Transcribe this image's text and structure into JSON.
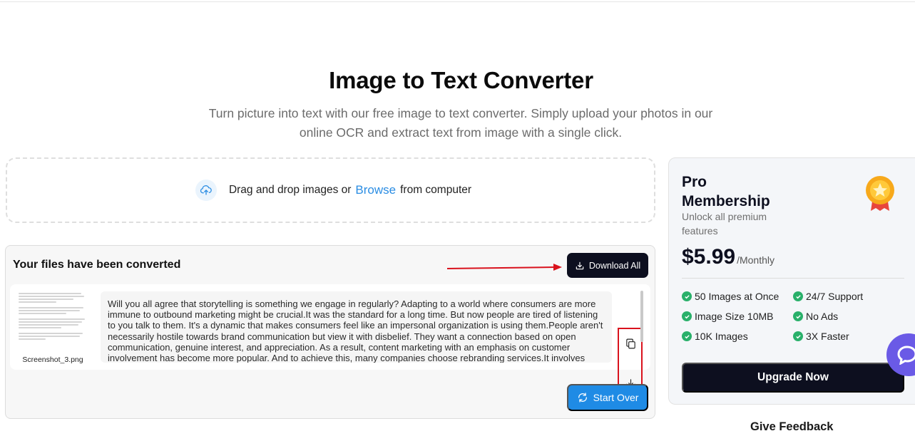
{
  "hero": {
    "title": "Image to Text Converter",
    "subtitle_line1": "Turn picture into text with our free image to text converter. Simply upload your photos in our",
    "subtitle_line2": "online OCR and extract text from image with a single click."
  },
  "upload": {
    "text_before": "Drag and drop images or",
    "browse_link": "Browse",
    "text_after": "from computer",
    "icon": "cloud-upload-icon"
  },
  "results": {
    "title": "Your files have been converted",
    "download_all_label": "Download All",
    "start_over_label": "Start Over",
    "files": [
      {
        "file_name": "Screenshot_3.png",
        "ocr_text": "Will you all agree that storytelling is something we engage in regularly? Adapting to a world where consumers are more immune to outbound marketing might be crucial.It was the standard for a long time. But now people are tired of listening to you talk to them. It's a dynamic that makes consumers feel like an impersonal organization is using them.People aren't necessarily hostile towards brand communication but view it with disbelief. They want a connection based on open communication, genuine interest, and appreciation. As a result, content marketing with an emphasis on customer involvement has become more popular. And to achieve this, many companies choose rebranding services.It involves"
      }
    ],
    "file_actions": [
      "copy-icon",
      "download-icon"
    ]
  },
  "pro": {
    "title": "Pro Membership",
    "subtitle": "Unlock all premium features",
    "price": "$5.99",
    "period": "/Monthly",
    "features": [
      "50 Images at Once",
      "24/7 Support",
      "Image Size 10MB",
      "No Ads",
      "10K Images",
      "3X Faster"
    ],
    "upgrade_label": "Upgrade Now"
  },
  "footer": {
    "feedback_label": "Give Feedback"
  },
  "colors": {
    "accent_blue": "#1f8be5",
    "dark_button": "#0d0f1f",
    "check_green": "#29b06a",
    "annotation_red": "#d9121d",
    "chat_purple": "#6a5ae6"
  }
}
